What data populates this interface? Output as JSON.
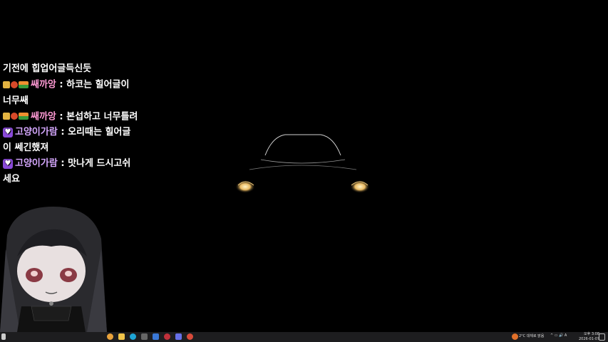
{
  "chat": {
    "messages": [
      {
        "badges": [],
        "nick": "",
        "text": "기전에 힙업어글득신듯"
      },
      {
        "badges": [
          "gold-badge",
          "fire-badge",
          "gift-badge"
        ],
        "nick": "쌔까앙",
        "sep": " : ",
        "text": "하코는 힐어글이 너무쌔"
      },
      {
        "badges": [
          "gold-badge",
          "fire-badge",
          "gift-badge"
        ],
        "nick": "쌔까앙",
        "sep": " : ",
        "text": "본섭하고 너무틀려"
      },
      {
        "badges": [
          "heart-badge"
        ],
        "nick": "고양이가람",
        "sep": " : ",
        "text": "오리때는 힐어글이 쎄긴했져"
      },
      {
        "badges": [
          "heart-badge"
        ],
        "nick": "고양이가람",
        "sep": " : ",
        "text": "맛나게 드시고쉬세요"
      }
    ]
  },
  "taskbar": {
    "weather": "2°C 대체로 맑음",
    "time": "오후 3:08",
    "date": "2026-01-07",
    "icons": [
      "start-icon",
      "chrome-icon",
      "folder-icon",
      "edge-icon",
      "pen-icon",
      "app-icon",
      "record-icon",
      "discord-icon",
      "media-icon"
    ]
  },
  "colors": {
    "nick_pink": "#ff9ad5",
    "nick_purple": "#d6a8ff",
    "taskbar": "#1d1d1f",
    "headlight": "#e8b860"
  }
}
